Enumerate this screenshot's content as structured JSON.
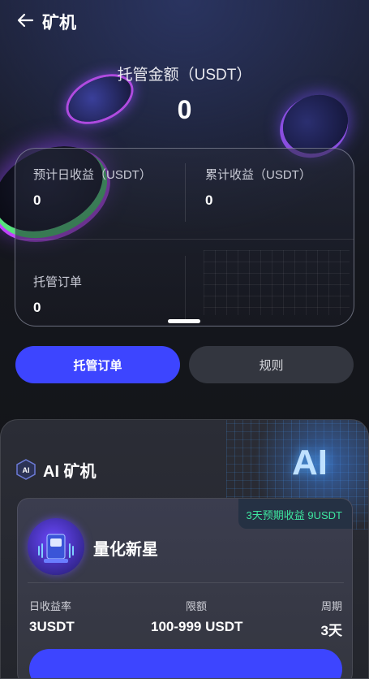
{
  "header": {
    "title": "矿机",
    "back_icon": "arrow-left-icon"
  },
  "summary": {
    "amount_label": "托管金额（USDT）",
    "amount_value": "0"
  },
  "stats": {
    "daily_label": "预计日收益（USDT）",
    "daily_value": "0",
    "total_label": "累计收益（USDT）",
    "total_value": "0",
    "orders_label": "托管订单",
    "orders_value": "0"
  },
  "buttons": {
    "orders": "托管订单",
    "rules": "规则"
  },
  "section": {
    "title": "AI 矿机",
    "badge_text": "AI",
    "deco_text": "AI",
    "product": {
      "yield_tag": "3天预期收益 9USDT",
      "name": "量化新星",
      "daily_rate_label": "日收益率",
      "daily_rate_value": "3USDT",
      "limit_label": "限额",
      "limit_value": "100-999 USDT",
      "period_label": "周期",
      "period_value": "3天"
    }
  },
  "colors": {
    "accent": "#3d45ff",
    "yield_green": "#3ee6a0",
    "secondary_button": "#33363f"
  }
}
